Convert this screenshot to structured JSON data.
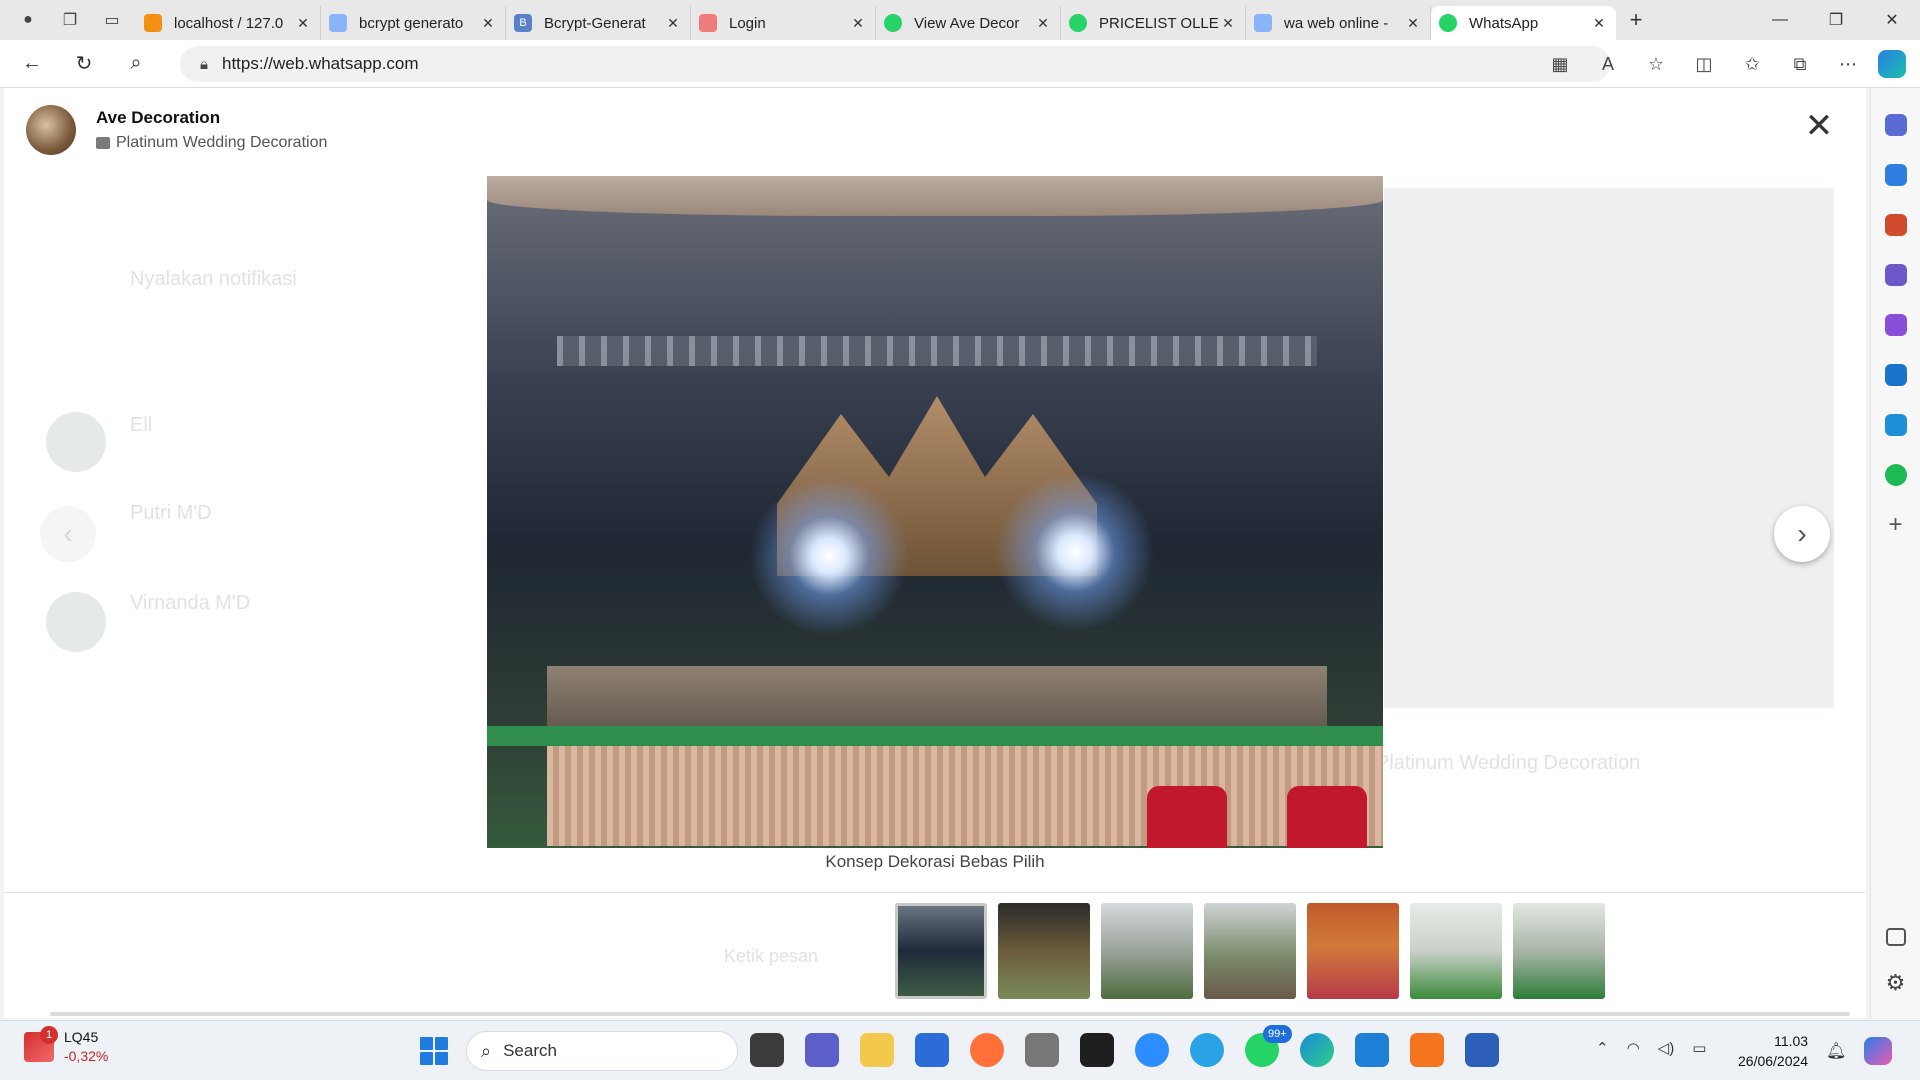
{
  "browser": {
    "tabs": [
      {
        "title": "localhost / 127.0",
        "favicon_color": "#f29111"
      },
      {
        "title": "bcrypt generato",
        "favicon_color": "#8ab4f8"
      },
      {
        "title": "Bcrypt-Generat",
        "favicon_color": "#5a7fc9"
      },
      {
        "title": "Login",
        "favicon_color": "#f07b7b"
      },
      {
        "title": "View Ave Decor",
        "favicon_color": "#25d366"
      },
      {
        "title": "PRICELIST OLLE",
        "favicon_color": "#25d366"
      },
      {
        "title": "wa web online -",
        "favicon_color": "#8ab4f8"
      },
      {
        "title": "WhatsApp",
        "favicon_color": "#25d366"
      }
    ],
    "url": "https://web.whatsapp.com"
  },
  "viewer": {
    "contact_name": "Ave Decoration",
    "subtitle": "Platinum Wedding Decoration",
    "caption": "Konsep Dekorasi Bebas Pilih",
    "thumbnails_count": 7
  },
  "background": {
    "notif_title": "Nyalakan notifikasi",
    "chat1_name": "Ell",
    "chat2_name": "Putri M'D",
    "chat3_name": "Virnanda M'D",
    "product_title": "Platinum Wedding Decoration",
    "message_placeholder": "Ketik pesan"
  },
  "taskbar": {
    "stock_ticker": "LQ45",
    "stock_change": "-0,32%",
    "stock_badge": "1",
    "search_placeholder": "Search",
    "whatsapp_badge": "99+",
    "time": "11.03",
    "date": "26/06/2024"
  }
}
